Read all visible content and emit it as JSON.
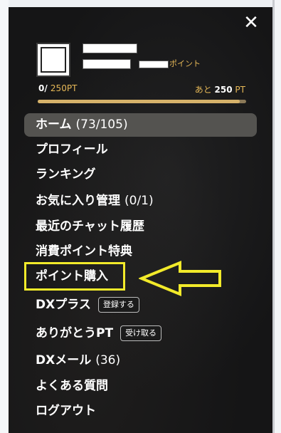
{
  "drawer": {
    "close_icon": "close-icon",
    "points_label": "ポイント",
    "points": {
      "current": "0/",
      "max": "250PT",
      "remaining_prefix": "あと",
      "remaining_value": "250",
      "remaining_unit": "PT",
      "progress": 0.97
    }
  },
  "menu": [
    {
      "label": "ホーム",
      "count": "(73/105)"
    },
    {
      "label": "プロフィール"
    },
    {
      "label": "ランキング"
    },
    {
      "label": "お気に入り管理",
      "count": "(0/1)"
    },
    {
      "label": "最近のチャット履歴"
    },
    {
      "label": "消費ポイント特典"
    },
    {
      "label": "ポイント購入"
    },
    {
      "label": "DXプラス",
      "pill": "登録する"
    },
    {
      "label": "ありがとうPT",
      "pill": "受け取る"
    },
    {
      "label": "DXメール",
      "count": "(36)"
    },
    {
      "label": "よくある質問"
    },
    {
      "label": "ログアウト"
    }
  ],
  "annotation": {
    "box_color": "#f2ea2a",
    "arrow_color": "#f2ea2a"
  },
  "colors": {
    "accent": "#e6b857",
    "panel": "#151516",
    "active_item": "#545350"
  }
}
